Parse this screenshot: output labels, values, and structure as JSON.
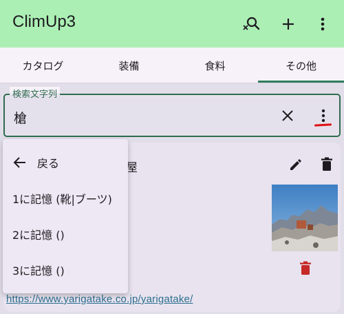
{
  "appbar": {
    "title": "ClimUp3",
    "icons": [
      "search-clear-icon",
      "plus-icon",
      "more-vert-icon"
    ]
  },
  "tabs": [
    {
      "label": "カタログ",
      "selected": false
    },
    {
      "label": "装備",
      "selected": false
    },
    {
      "label": "食料",
      "selected": false
    },
    {
      "label": "その他",
      "selected": true
    }
  ],
  "search": {
    "legend": "検索文字列",
    "value": "槍"
  },
  "menu": {
    "back_label": "戻る",
    "items": [
      "1に記憶 (靴|ブーツ)",
      "2に記憶 ()",
      "3に記憶 ()"
    ]
  },
  "card": {
    "title_partial": "屋",
    "link": "https://www.yarigatake.co.jp/yarigatake/"
  },
  "colors": {
    "appbar": "#acefb4",
    "accent": "#2e6b4e",
    "delete_red": "#c62828",
    "annotation_red": "#e01010"
  }
}
